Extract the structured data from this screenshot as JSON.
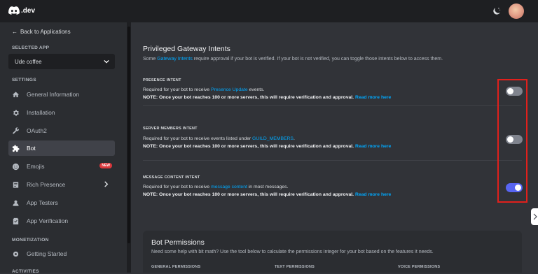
{
  "topbar": {
    "logo_text": ".dev"
  },
  "sidebar": {
    "back_label": "Back to Applications",
    "selected_app_label": "SELECTED APP",
    "selected_app": "Ude coffee",
    "settings_label": "SETTINGS",
    "items": [
      {
        "label": "General Information",
        "icon": "home-icon"
      },
      {
        "label": "Installation",
        "icon": "gear-icon"
      },
      {
        "label": "OAuth2",
        "icon": "wrench-icon"
      },
      {
        "label": "Bot",
        "icon": "puzzle-icon"
      },
      {
        "label": "Emojis",
        "icon": "emoji-icon",
        "badge": "NEW"
      },
      {
        "label": "Rich Presence",
        "icon": "document-icon"
      },
      {
        "label": "App Testers",
        "icon": "user-icon"
      },
      {
        "label": "App Verification",
        "icon": "checklist-icon"
      }
    ],
    "monetization_label": "MONETIZATION",
    "monetization_items": [
      {
        "label": "Getting Started",
        "icon": "gear-icon"
      }
    ],
    "activities_label": "ACTIVITIES"
  },
  "intents": {
    "title": "Privileged Gateway Intents",
    "desc_pre": "Some ",
    "desc_link": "Gateway Intents",
    "desc_post": " require approval if your bot is verified. If your bot is not verified, you can toggle those intents below to access them.",
    "note": "NOTE: Once your bot reaches 100 or more servers, this will require verification and approval.",
    "read_more": "Read more here",
    "items": [
      {
        "title": "PRESENCE INTENT",
        "pre": "Required for your bot to receive ",
        "link": "Presence Update",
        "post": " events.",
        "enabled": false
      },
      {
        "title": "SERVER MEMBERS INTENT",
        "pre": "Required for your bot to receive events listed under ",
        "link": "GUILD_MEMBERS",
        "post": ".",
        "enabled": false
      },
      {
        "title": "MESSAGE CONTENT INTENT",
        "pre": "Required for your bot to receive ",
        "link": "message content",
        "post": " in most messages.",
        "enabled": true
      }
    ]
  },
  "permissions": {
    "title": "Bot Permissions",
    "desc": "Need some help with bit math? Use the tool below to calculate the permissions integer for your bot based on the features it needs.",
    "columns": [
      "GENERAL PERMISSIONS",
      "TEXT PERMISSIONS",
      "VOICE PERMISSIONS"
    ]
  },
  "colors": {
    "accent": "#5865f2",
    "link": "#00a8fc",
    "highlight": "#e0201c",
    "danger": "#da373c"
  }
}
